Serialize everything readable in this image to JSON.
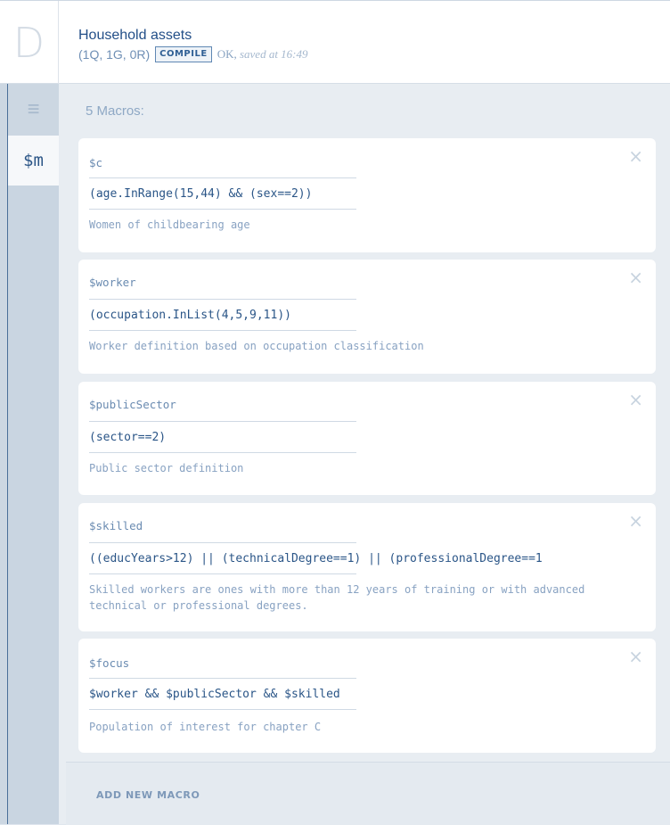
{
  "app": {
    "logo_letter": "D"
  },
  "header": {
    "title": "Household assets",
    "counts": "(1Q, 1G, 0R)",
    "compile_label": "COMPILE",
    "status_ok": "OK,",
    "status_saved": "saved at 16:49"
  },
  "sidebar": {
    "menu_icon": "≡",
    "macros_icon_label": "$m"
  },
  "macros": {
    "heading": "5 Macros:",
    "items": [
      {
        "name": "$c",
        "expression": "(age.InRange(15,44) && (sex==2))",
        "description": "Women of childbearing age"
      },
      {
        "name": "$worker",
        "expression": "(occupation.InList(4,5,9,11))",
        "description": "Worker definition based on occupation classification"
      },
      {
        "name": "$publicSector",
        "expression": "(sector==2)",
        "description": "Public sector definition"
      },
      {
        "name": "$skilled",
        "expression": "((educYears>12) || (technicalDegree==1) || (professionalDegree==1",
        "description": "Skilled workers are ones with more than 12 years of training or with advanced technical or professional degrees."
      },
      {
        "name": "$focus",
        "expression": "$worker && $publicSector && $skilled",
        "description": "Population of interest for chapter C"
      }
    ],
    "add_label": "ADD NEW MACRO"
  },
  "icons": {
    "close": "×"
  },
  "colors": {
    "accent": "#2c5687",
    "muted": "#88a2c2",
    "background": "#e8edf2"
  }
}
